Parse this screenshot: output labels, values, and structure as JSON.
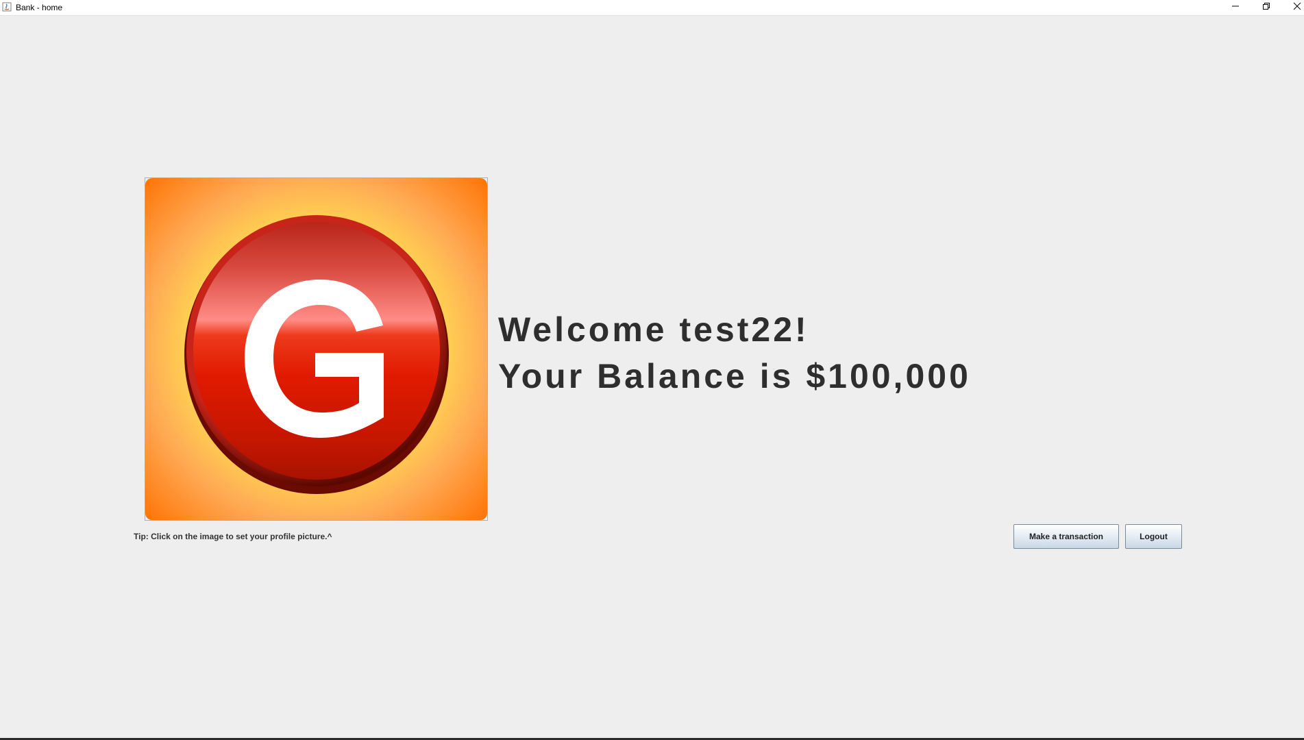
{
  "window": {
    "title": "Bank - home",
    "controls": {
      "minimize_icon": "minimize-icon",
      "maximize_icon": "restore-icon",
      "close_icon": "close-icon"
    }
  },
  "profile": {
    "image_icon": "g-logo-icon",
    "letter": "G",
    "colors": {
      "background_center": "#ffff55",
      "background_edge": "#ff7a00",
      "circle_red": "#e01a00",
      "circle_dark": "#7a0a00",
      "letter": "#ffffff"
    }
  },
  "main": {
    "welcome": "Welcome test22!",
    "balance": "Your Balance is $100,000",
    "tip": "Tip: Click on the image to set your profile picture.^"
  },
  "actions": {
    "transaction_label": "Make a transaction",
    "logout_label": "Logout"
  }
}
